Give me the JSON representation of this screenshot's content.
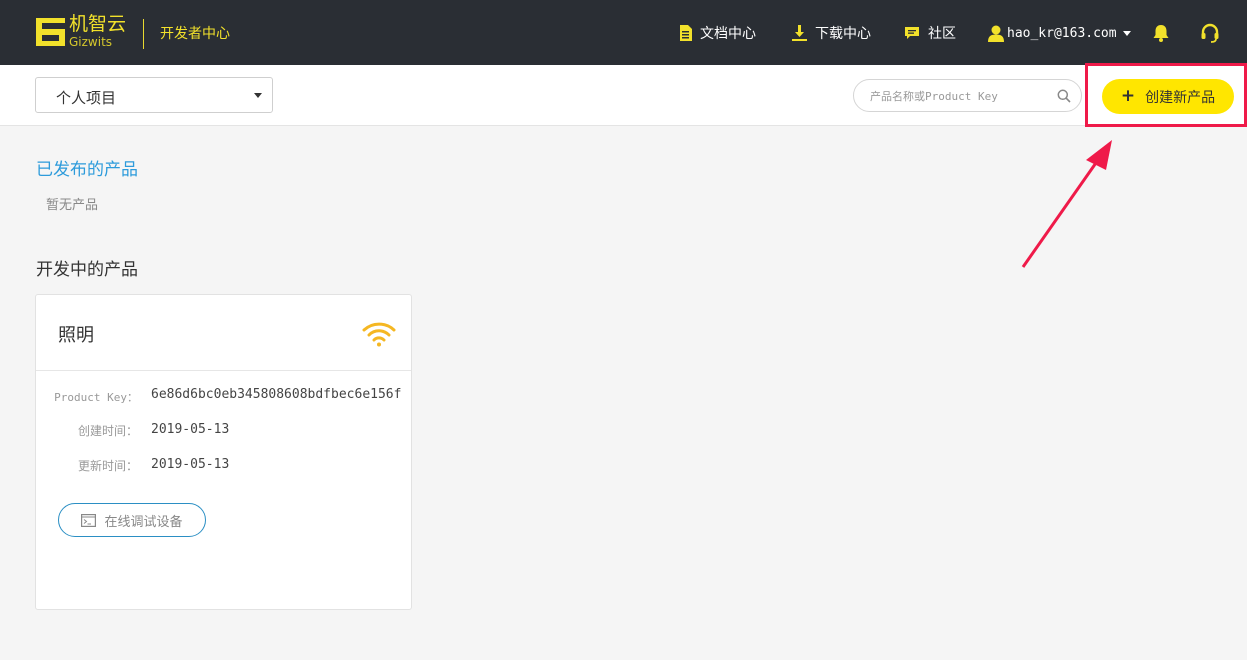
{
  "header": {
    "logo_cn": "机智云",
    "logo_en": "Gizwits",
    "section_title": "开发者中心",
    "nav": [
      {
        "label": "文档中心",
        "icon": "document-icon"
      },
      {
        "label": "下载中心",
        "icon": "download-icon"
      },
      {
        "label": "社区",
        "icon": "chat-icon"
      }
    ],
    "user_email": "hao_kr@163.com",
    "accent_color": "#f2e12b",
    "bg_color": "#2a2e34"
  },
  "toolbar": {
    "project_select_value": "个人项目",
    "search_placeholder": "产品名称或Product Key",
    "create_button_label": "创建新产品",
    "create_button_color": "#ffe600",
    "highlight_color": "#ef1a49"
  },
  "main": {
    "published_title": "已发布的产品",
    "published_empty": "暂无产品",
    "developing_title": "开发中的产品",
    "products": [
      {
        "name": "照明",
        "product_key_label": "Product Key：",
        "product_key": "6e86d6bc0eb345808608bdfbec6e156f",
        "created_label": "创建时间：",
        "created": "2019-05-13",
        "updated_label": "更新时间：",
        "updated": "2019-05-13",
        "debug_button_label": "在线调试设备"
      }
    ]
  }
}
